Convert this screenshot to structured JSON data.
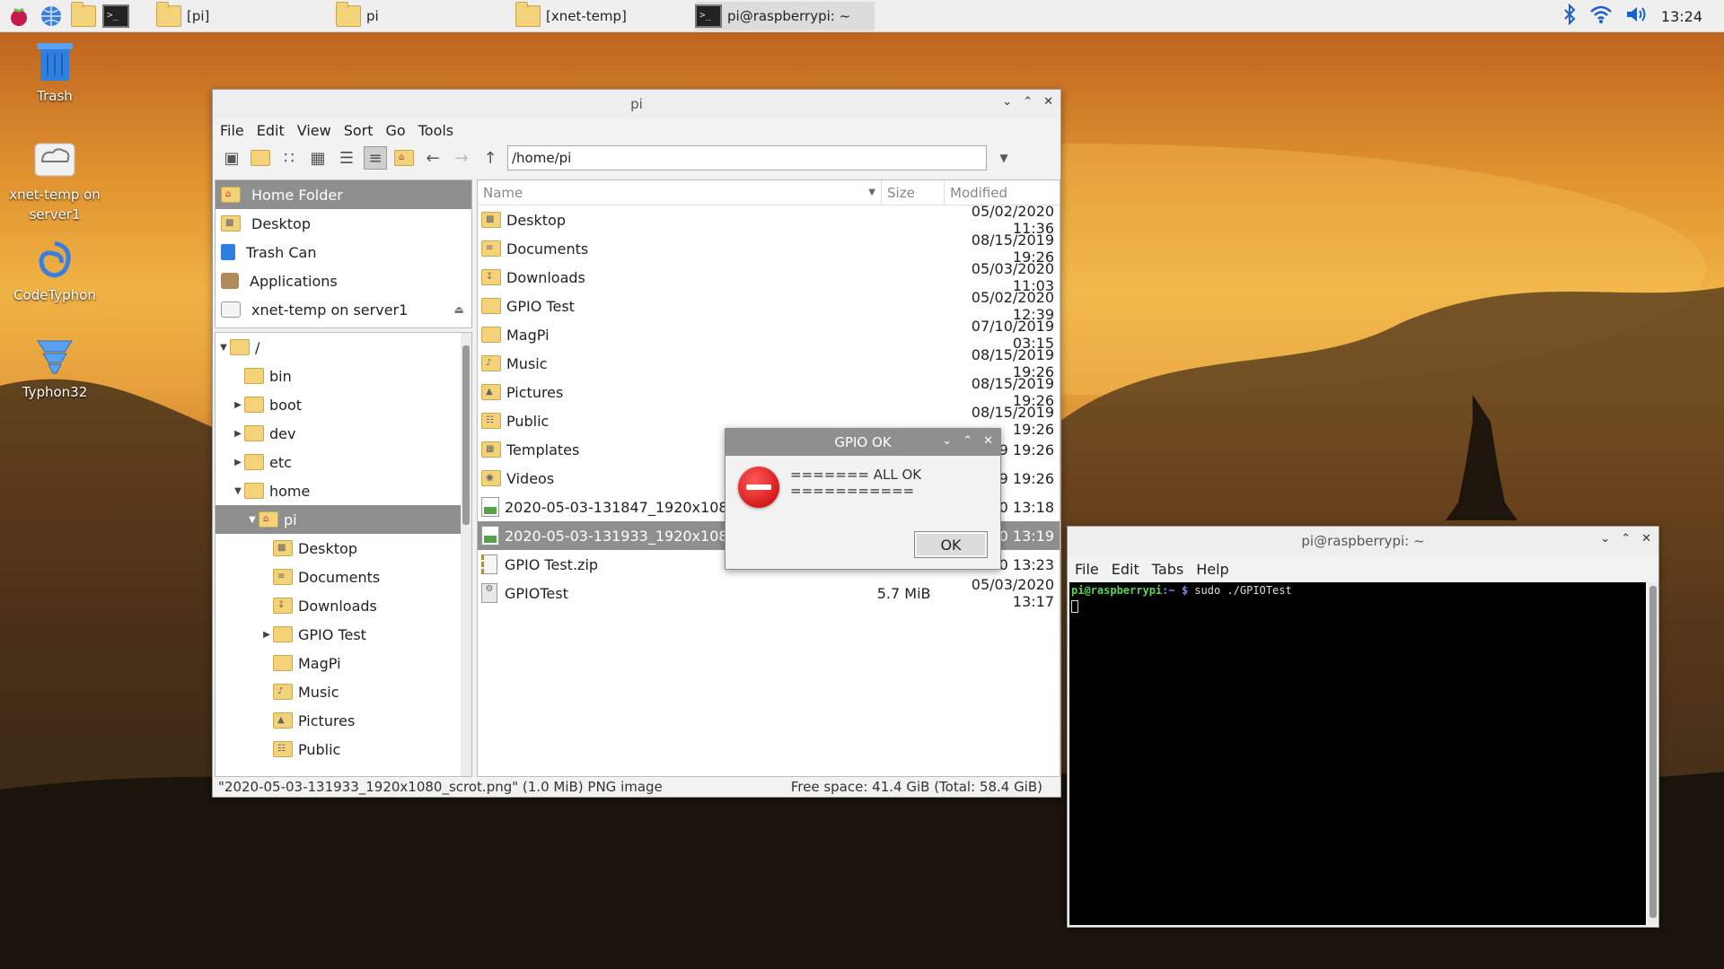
{
  "taskbar": {
    "tasks": [
      "[pi]",
      "pi",
      "[xnet-temp]",
      "pi@raspberrypi: ~"
    ],
    "clock": "13:24",
    "tray_icons": [
      "bluetooth-icon",
      "wifi-icon",
      "volume-icon"
    ]
  },
  "desktop": {
    "icons": [
      {
        "label": "Trash",
        "icon": "trash-icon"
      },
      {
        "label": "xnet-temp on server1",
        "icon": "network-drive-icon"
      },
      {
        "label": "CodeTyphon",
        "icon": "codetyphon-icon"
      },
      {
        "label": "Typhon32",
        "icon": "typhon32-icon"
      }
    ]
  },
  "file_manager": {
    "title": "pi",
    "menu": [
      "File",
      "Edit",
      "View",
      "Sort",
      "Go",
      "Tools"
    ],
    "address": "/home/pi",
    "places": [
      {
        "label": "Home Folder",
        "icon": "home-icon",
        "selected": true
      },
      {
        "label": "Desktop",
        "icon": "desktop-icon"
      },
      {
        "label": "Trash Can",
        "icon": "trash-icon"
      },
      {
        "label": "Applications",
        "icon": "applications-icon"
      },
      {
        "label": "xnet-temp on server1",
        "icon": "network-drive-icon"
      }
    ],
    "tree": [
      {
        "label": "/",
        "expander": "expanded"
      },
      {
        "label": "bin",
        "expander": "none"
      },
      {
        "label": "boot",
        "expander": "collapsed"
      },
      {
        "label": "dev",
        "expander": "collapsed"
      },
      {
        "label": "etc",
        "expander": "collapsed"
      },
      {
        "label": "home",
        "expander": "expanded"
      },
      {
        "label": "pi",
        "expander": "expanded",
        "selected": true
      },
      {
        "label": "Desktop",
        "expander": "none"
      },
      {
        "label": "Documents",
        "expander": "none"
      },
      {
        "label": "Downloads",
        "expander": "none"
      },
      {
        "label": "GPIO Test",
        "expander": "collapsed"
      },
      {
        "label": "MagPi",
        "expander": "none"
      },
      {
        "label": "Music",
        "expander": "none"
      },
      {
        "label": "Pictures",
        "expander": "none"
      },
      {
        "label": "Public",
        "expander": "none"
      }
    ],
    "columns": {
      "name": "Name",
      "size": "Size",
      "modified": "Modified"
    },
    "files": [
      {
        "name": "Desktop",
        "size": "",
        "modified": "05/02/2020 11:36",
        "icon": "desktop-folder-icon"
      },
      {
        "name": "Documents",
        "size": "",
        "modified": "08/15/2019 19:26",
        "icon": "documents-folder-icon"
      },
      {
        "name": "Downloads",
        "size": "",
        "modified": "05/03/2020 11:03",
        "icon": "downloads-folder-icon"
      },
      {
        "name": "GPIO Test",
        "size": "",
        "modified": "05/02/2020 12:39",
        "icon": "folder-icon"
      },
      {
        "name": "MagPi",
        "size": "",
        "modified": "07/10/2019 03:15",
        "icon": "folder-icon"
      },
      {
        "name": "Music",
        "size": "",
        "modified": "08/15/2019 19:26",
        "icon": "music-folder-icon"
      },
      {
        "name": "Pictures",
        "size": "",
        "modified": "08/15/2019 19:26",
        "icon": "pictures-folder-icon"
      },
      {
        "name": "Public",
        "size": "",
        "modified": "08/15/2019 19:26",
        "icon": "public-folder-icon"
      },
      {
        "name": "Templates",
        "size": "",
        "modified": "19 19:26",
        "icon": "templates-folder-icon"
      },
      {
        "name": "Videos",
        "size": "",
        "modified": "19 19:26",
        "icon": "videos-folder-icon"
      },
      {
        "name": "2020-05-03-131847_1920x1080_sc",
        "size": "",
        "modified": "20 13:18",
        "icon": "image-file-icon"
      },
      {
        "name": "2020-05-03-131933_1920x1080_sc",
        "size": "",
        "modified": "20 13:19",
        "icon": "image-file-icon",
        "selected": true
      },
      {
        "name": "GPIO Test.zip",
        "size": "",
        "modified": "20 13:23",
        "icon": "zip-file-icon"
      },
      {
        "name": "GPIOTest",
        "size": "5.7 MiB",
        "modified": "05/03/2020 13:17",
        "icon": "executable-file-icon"
      }
    ],
    "status_left": "\"2020-05-03-131933_1920x1080_scrot.png\" (1.0 MiB) PNG image",
    "status_right": "Free space: 41.4 GiB (Total: 58.4 GiB)"
  },
  "dialog": {
    "title": "GPIO OK",
    "message": "======= ALL OK ===========",
    "ok_label": "OK"
  },
  "terminal": {
    "title": "pi@raspberrypi: ~",
    "menu": [
      "File",
      "Edit",
      "Tabs",
      "Help"
    ],
    "prompt_user": "pi@raspberrypi",
    "prompt_path": ":~ $",
    "command": "sudo ./GPIOTest"
  }
}
